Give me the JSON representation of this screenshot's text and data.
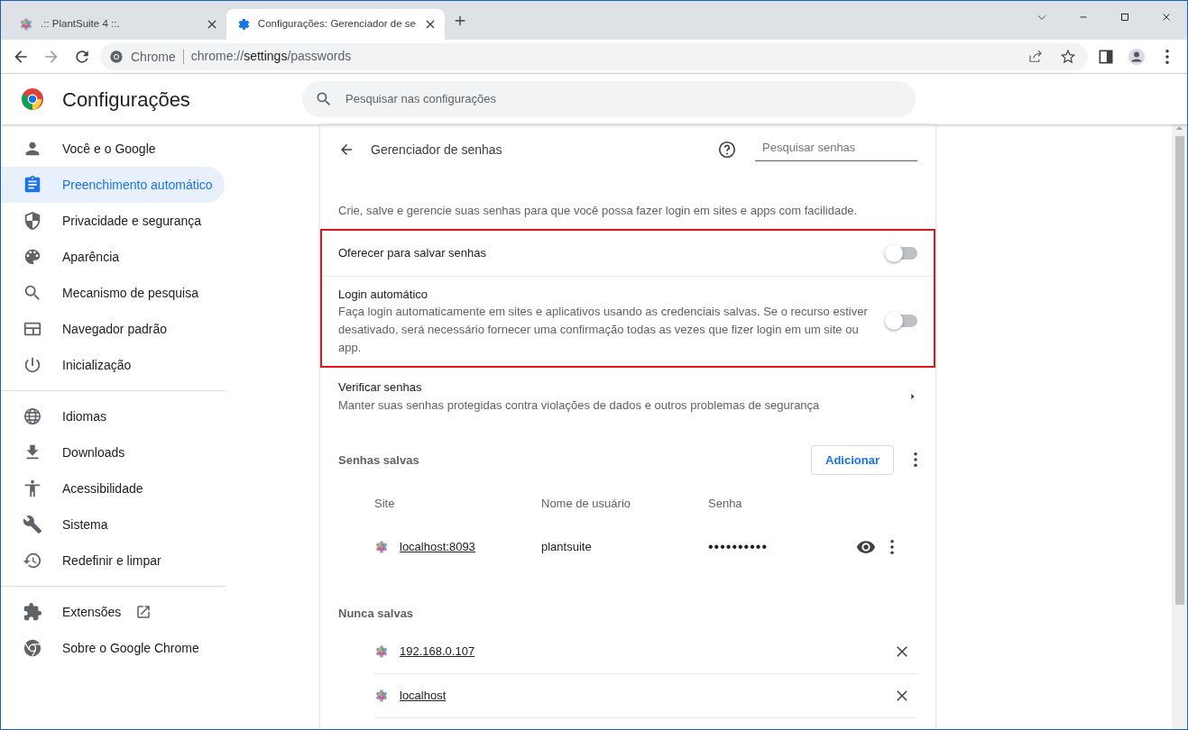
{
  "tabs": [
    {
      "title": ".:: PlantSuite 4 ::.",
      "selected": false,
      "kind": "site"
    },
    {
      "title": "Configurações: Gerenciador de se",
      "selected": true,
      "kind": "settings"
    }
  ],
  "address_bar": {
    "chip": "Chrome",
    "url": [
      {
        "text": "chrome://",
        "emphasis": false
      },
      {
        "text": "settings",
        "emphasis": true
      },
      {
        "text": "/passwords",
        "emphasis": false
      }
    ]
  },
  "header": {
    "title": "Configurações",
    "search_placeholder": "Pesquisar nas configurações"
  },
  "sidebar": {
    "sections": [
      {
        "items": [
          {
            "label": "Você e o Google",
            "selected": false,
            "external_link": false
          },
          {
            "label": "Preenchimento automático",
            "selected": true,
            "external_link": false
          },
          {
            "label": "Privacidade e segurança",
            "selected": false,
            "external_link": false
          },
          {
            "label": "Aparência",
            "selected": false,
            "external_link": false
          },
          {
            "label": "Mecanismo de pesquisa",
            "selected": false,
            "external_link": false
          },
          {
            "label": "Navegador padrão",
            "selected": false,
            "external_link": false
          },
          {
            "label": "Inicialização",
            "selected": false,
            "external_link": false
          }
        ]
      },
      {
        "items": [
          {
            "label": "Idiomas",
            "selected": false,
            "external_link": false
          },
          {
            "label": "Downloads",
            "selected": false,
            "external_link": false
          },
          {
            "label": "Acessibilidade",
            "selected": false,
            "external_link": false
          },
          {
            "label": "Sistema",
            "selected": false,
            "external_link": false
          },
          {
            "label": "Redefinir e limpar",
            "selected": false,
            "external_link": false
          }
        ]
      },
      {
        "items": [
          {
            "label": "Extensões",
            "selected": false,
            "external_link": true
          },
          {
            "label": "Sobre o Google Chrome",
            "selected": false,
            "external_link": false
          }
        ]
      }
    ]
  },
  "page": {
    "title": "Gerenciador de senhas",
    "search_placeholder": "Pesquisar senhas",
    "intro": "Crie, salve e gerencie suas senhas para que você possa fazer login em sites e apps com facilidade.",
    "setting_groups": [
      {
        "highlighted": true,
        "rows": [
          {
            "kind": "toggle",
            "label": "Oferecer para salvar senhas",
            "on": false
          },
          {
            "kind": "toggle",
            "label": "Login automático",
            "description": "Faça login automaticamente em sites e aplicativos usando as credenciais salvas. Se o recurso estiver desativado, será necessário fornecer uma confirmação todas as vezes que fizer login em um site ou app.",
            "on": false
          }
        ]
      },
      {
        "highlighted": false,
        "rows": [
          {
            "kind": "link",
            "label": "Verificar senhas",
            "description": "Manter suas senhas protegidas contra violações de dados e outros problemas de segurança"
          }
        ]
      }
    ],
    "saved": {
      "title": "Senhas salvas",
      "add_button": "Adicionar",
      "columns": [
        "Site",
        "Nome de usuário",
        "Senha"
      ],
      "rows": [
        {
          "site": "localhost:8093",
          "username": "plantsuite",
          "password": "••••••••••"
        }
      ]
    },
    "never_saved": {
      "title": "Nunca salvas",
      "sites": [
        "192.168.0.107",
        "localhost"
      ]
    }
  }
}
